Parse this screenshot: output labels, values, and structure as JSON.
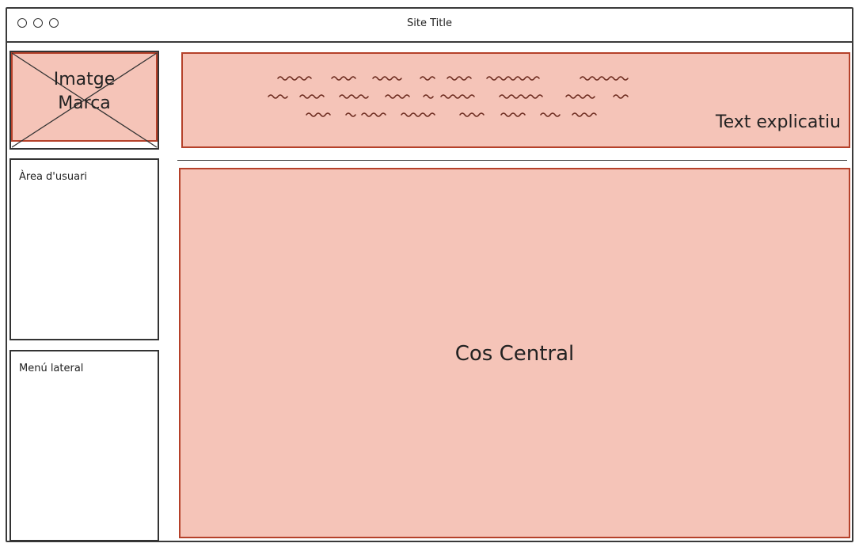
{
  "window": {
    "title": "Site Title"
  },
  "brand": {
    "label": "Imatge\nMarca"
  },
  "header": {
    "label": "Text explicatiu"
  },
  "sidebar": {
    "user_area_label": "Àrea d'usuari",
    "menu_label": "Menú lateral"
  },
  "main": {
    "label": "Cos Central"
  },
  "colors": {
    "fill": "#f5c4b8",
    "border": "#b5412a",
    "ink": "#333333"
  }
}
